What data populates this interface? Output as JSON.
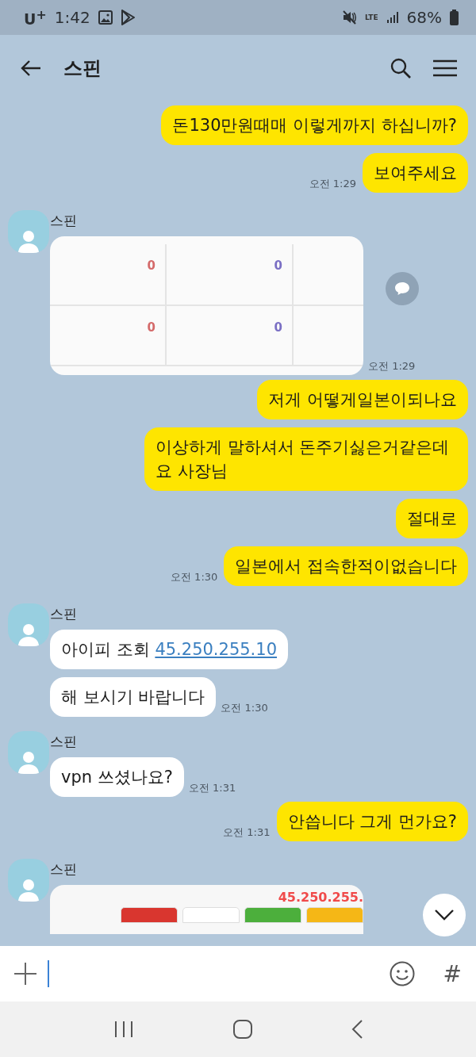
{
  "status_bar": {
    "carrier": "U$^{+}$",
    "time": "1:42",
    "network": "LTE",
    "battery": "68%"
  },
  "header": {
    "title": "스핀"
  },
  "messages": [
    {
      "kind": "sent",
      "text": "돈130만원때매 이렇게까지 하십니까?"
    },
    {
      "kind": "sent",
      "text": "보여주세요",
      "time": "오전 1:29"
    },
    {
      "kind": "received",
      "sender": "스핀",
      "bubbles": [
        {
          "kind": "table_image",
          "time": "오전 1:29",
          "share": true,
          "rows": [
            {
              "cells": [
                {
                  "text": "0",
                  "color": "#d46a6a"
                },
                {
                  "text": "0",
                  "color": "#7a6fc4"
                }
              ]
            },
            {
              "cells": [
                {
                  "text": "0",
                  "color": "#d46a6a"
                },
                {
                  "text": "0",
                  "color": "#7a6fc4"
                }
              ]
            }
          ]
        }
      ]
    },
    {
      "kind": "sent",
      "text": "저게 어떻게일본이되나요"
    },
    {
      "kind": "sent",
      "text": "이상하게 말하셔서 돈주기싫은거같은데요 사장님"
    },
    {
      "kind": "sent",
      "text": "절대로"
    },
    {
      "kind": "sent",
      "text": "일본에서 접속한적이없습니다",
      "time": "오전 1:30"
    },
    {
      "kind": "received",
      "sender": "스핀",
      "bubbles": [
        {
          "kind": "text",
          "text": "아이피 조회",
          "link": "45.250.255.10"
        },
        {
          "kind": "text",
          "text": "해 보시기 바랍니다",
          "time": "오전 1:30"
        }
      ]
    },
    {
      "kind": "received",
      "sender": "스핀",
      "bubbles": [
        {
          "kind": "text",
          "text": "vpn 쓰셨나요?",
          "time": "오전 1:31"
        }
      ]
    },
    {
      "kind": "sent",
      "text": "안씁니다 그게 먼가요?",
      "time": "오전 1:31"
    },
    {
      "kind": "received",
      "sender": "스핀",
      "bubbles": [
        {
          "kind": "result_image",
          "text": "45.250.255.",
          "chips": [
            {
              "color": "#d9362f"
            },
            {
              "color": "#ffffff"
            },
            {
              "color": "#4caf3c"
            },
            {
              "color": "#f5b716"
            }
          ]
        }
      ]
    }
  ],
  "composer": {
    "hash": "#"
  }
}
